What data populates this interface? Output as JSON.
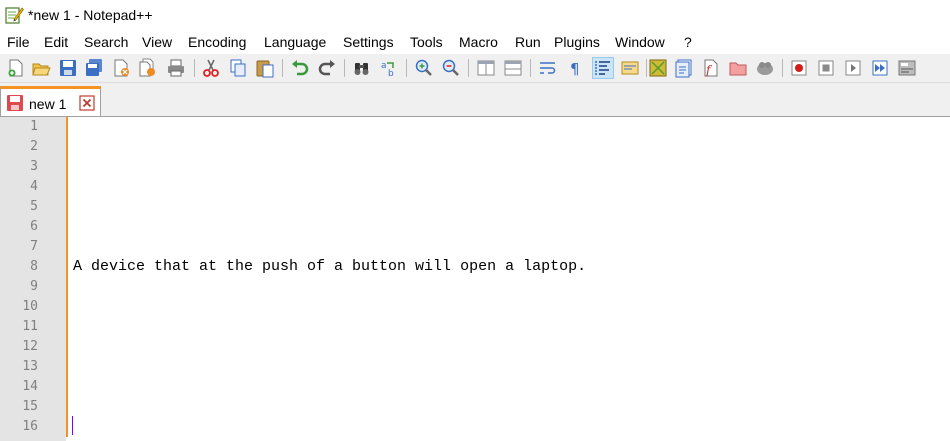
{
  "window": {
    "title": "*new 1 - Notepad++"
  },
  "menu": {
    "items": [
      "File",
      "Edit",
      "Search",
      "View",
      "Encoding",
      "Language",
      "Settings",
      "Tools",
      "Macro",
      "Run",
      "Plugins",
      "Window",
      "?"
    ]
  },
  "toolbar": {
    "buttons": [
      "new-file",
      "open-file",
      "save",
      "save-all",
      "close",
      "close-all",
      "print",
      "cut",
      "copy",
      "paste",
      "undo",
      "redo",
      "find",
      "replace",
      "zoom-in",
      "zoom-out",
      "sync-vertical-scroll",
      "sync-horizontal-scroll",
      "word-wrap",
      "show-all-characters",
      "indent-guide",
      "user-defined-language",
      "document-map",
      "function-list",
      "folder-as-workspace",
      "monitoring",
      "start-recording",
      "stop-recording",
      "playback",
      "run-macro-multiple",
      "save-macro"
    ]
  },
  "tabs": [
    {
      "label": "new 1",
      "modified": true
    }
  ],
  "editor": {
    "line_numbers": [
      "1",
      "2",
      "3",
      "4",
      "5",
      "6",
      "7",
      "8",
      "9",
      "10",
      "11",
      "12",
      "13",
      "14",
      "15",
      "16"
    ],
    "lines": {
      "line_8": "A device that at the push of a button will open a laptop."
    }
  },
  "colors": {
    "accent_orange": "#f59322",
    "gutter_bg": "#e4e4e4",
    "line_number": "#808080",
    "caret": "#8000ff"
  }
}
